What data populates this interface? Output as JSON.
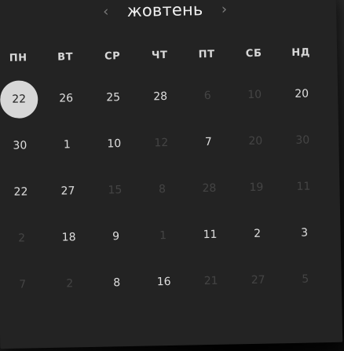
{
  "calendar": {
    "month": "жовтень",
    "prev_icon": "chevron-left-icon",
    "next_icon": "chevron-right-icon",
    "weekdays": [
      "ПН",
      "ВТ",
      "СР",
      "ЧТ",
      "ПТ",
      "СБ",
      "НД"
    ],
    "weeks": [
      [
        "22",
        "26",
        "25",
        "28",
        "6",
        "10",
        "20"
      ],
      [
        "30",
        "1",
        "10",
        "12",
        "7",
        "20",
        "30"
      ],
      [
        "22",
        "27",
        "15",
        "8",
        "28",
        "19",
        "11"
      ],
      [
        "2",
        "18",
        "9",
        "1",
        "11",
        "2",
        "3"
      ],
      [
        "7",
        "2",
        "8",
        "16",
        "21",
        "27",
        "5"
      ]
    ],
    "muted": [
      [
        false,
        false,
        false,
        false,
        true,
        true,
        false
      ],
      [
        false,
        false,
        false,
        true,
        false,
        true,
        true
      ],
      [
        false,
        false,
        true,
        true,
        true,
        true,
        true
      ],
      [
        true,
        false,
        false,
        true,
        false,
        false,
        false
      ],
      [
        true,
        true,
        false,
        false,
        true,
        true,
        true
      ]
    ],
    "today": "22"
  }
}
